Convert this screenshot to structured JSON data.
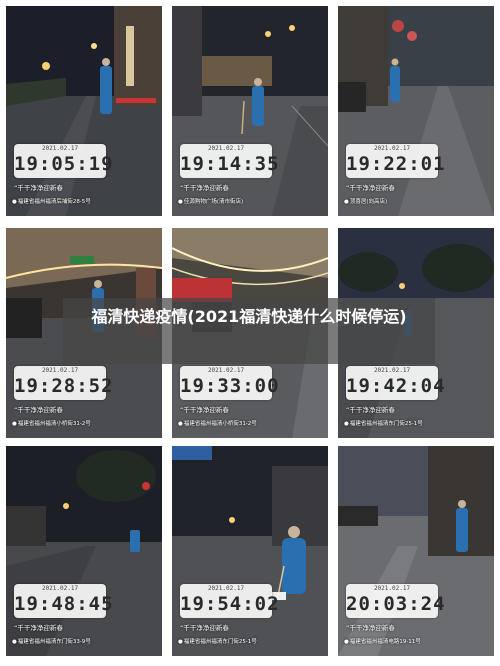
{
  "title": "福清快递疫情(2021福清快递什么时候停运)",
  "photos": [
    {
      "date": "2021.02.17",
      "time": "19:05:19",
      "caption": "千干净净迎新春",
      "location": "福建省福州福清后埔街28-5号"
    },
    {
      "date": "2021.02.17",
      "time": "19:14:35",
      "caption": "千干净净迎新春",
      "location": "佳源购物广场(清市街店)"
    },
    {
      "date": "2021.02.17",
      "time": "19:22:01",
      "caption": "千干净净迎新春",
      "location": "顶喜居(向高店)"
    },
    {
      "date": "2021.02.17",
      "time": "19:28:52",
      "caption": "千干净净迎新春",
      "location": "福建省福州福清小桥街31-2号"
    },
    {
      "date": "2021.02.17",
      "time": "19:33:00",
      "caption": "千干净净迎新春",
      "location": "福建省福州福清小桥街31-2号"
    },
    {
      "date": "2021.02.17",
      "time": "19:42:04",
      "caption": "千干净净迎新春",
      "location": "福建省福州福清东门街25-1号"
    },
    {
      "date": "2021.02.17",
      "time": "19:48:45",
      "caption": "千干净净迎新春",
      "location": "福建省福州福清东门街33-9号"
    },
    {
      "date": "2021.02.17",
      "time": "19:54:02",
      "caption": "千干净净迎新春",
      "location": "福建省福州福清东门街25-1号"
    },
    {
      "date": "2021.02.17",
      "time": "20:03:24",
      "caption": "千干净净迎新春",
      "location": "福建省福州福清电路19-11号"
    }
  ]
}
